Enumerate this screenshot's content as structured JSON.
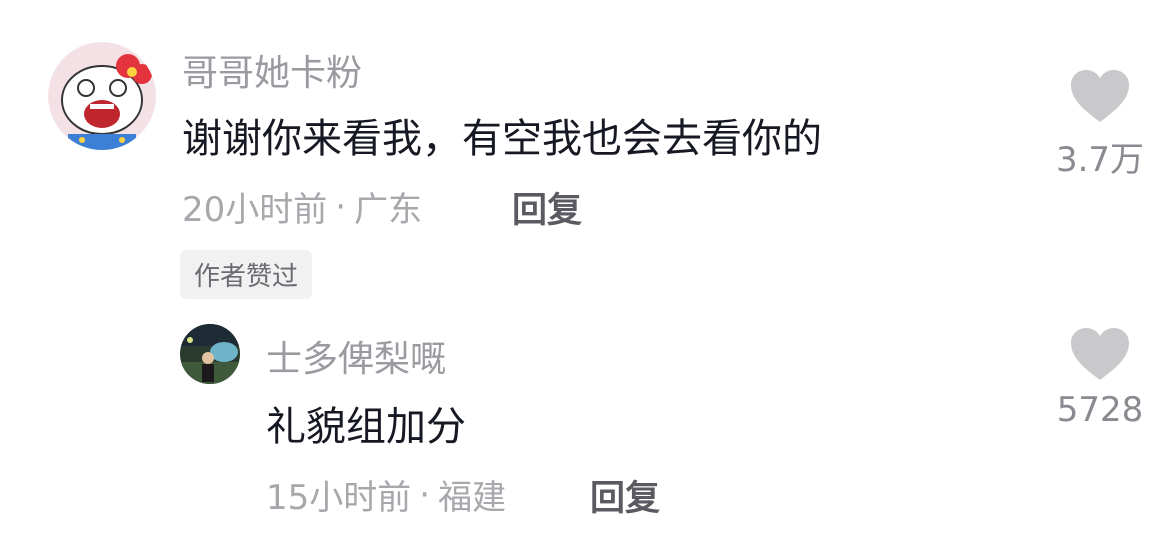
{
  "comments": [
    {
      "username": "哥哥她卡粉",
      "content": "谢谢你来看我，有空我也会去看你的",
      "time": "20小时前",
      "separator": "·",
      "location": "广东",
      "reply_label": "回复",
      "badge": "作者赞过",
      "likes": "3.7万",
      "avatar_icon": "hello-kitty-avatar"
    },
    {
      "username": "士多俾梨嘅",
      "content": "礼貌组加分",
      "time": "15小时前",
      "separator": "·",
      "location": "福建",
      "reply_label": "回复",
      "likes": "5728",
      "avatar_icon": "photo-avatar"
    }
  ],
  "colors": {
    "username": "#9a9ba0",
    "content": "#161823",
    "meta": "#a7a8ac",
    "heart": "#c9c9cb",
    "badge_bg": "#f1f1f2"
  }
}
